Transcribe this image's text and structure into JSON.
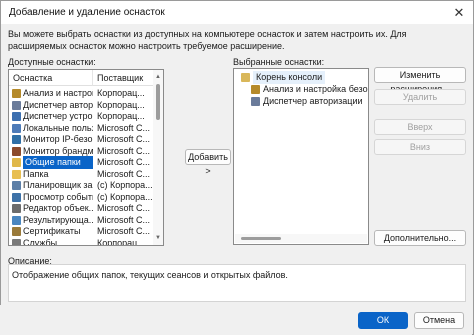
{
  "window": {
    "title": "Добавление и удаление оснасток",
    "close_glyph": "✕"
  },
  "intro": {
    "line1": "Вы можете выбрать оснастки из доступных на компьютере оснасток и затем настроить их. Для",
    "line2": "расширяемых оснасток можно настроить требуемое расширение."
  },
  "available": {
    "label": "Доступные оснастки:",
    "columns": [
      "Оснастка",
      "Поставщик"
    ],
    "items": [
      {
        "name": "Анализ и настройка...",
        "vendor": "Корпорац...",
        "icon": "security-analysis-icon",
        "color": "#b58a2a"
      },
      {
        "name": "Диспетчер автор...",
        "vendor": "Корпорац...",
        "icon": "authorization-manager-icon",
        "color": "#6a7b9a"
      },
      {
        "name": "Диспетчер устро...",
        "vendor": "Корпорац...",
        "icon": "device-manager-icon",
        "color": "#3c6fb0"
      },
      {
        "name": "Локальные польз...",
        "vendor": "Microsoft C...",
        "icon": "local-users-icon",
        "color": "#4d7bb8"
      },
      {
        "name": "Монитор IP-безо...",
        "vendor": "Microsoft C...",
        "icon": "ip-security-monitor-icon",
        "color": "#2f6fa6"
      },
      {
        "name": "Монитор брандм...",
        "vendor": "Microsoft C...",
        "icon": "firewall-monitor-icon",
        "color": "#8b4a2b"
      },
      {
        "name": "Общие папки",
        "vendor": "Microsoft C...",
        "icon": "shared-folders-icon",
        "color": "#e0b84a",
        "selected": true
      },
      {
        "name": "Папка",
        "vendor": "Microsoft C...",
        "icon": "folder-icon",
        "color": "#e8bf52"
      },
      {
        "name": "Планировщик за...",
        "vendor": "(с) Корпора...",
        "icon": "task-scheduler-icon",
        "color": "#5c7fa8"
      },
      {
        "name": "Просмотр событий",
        "vendor": "(с) Корпора...",
        "icon": "event-viewer-icon",
        "color": "#3e72a8"
      },
      {
        "name": "Редактор объек...",
        "vendor": "Microsoft C...",
        "icon": "object-editor-icon",
        "color": "#6c6c6c"
      },
      {
        "name": "Результирующа...",
        "vendor": "Microsoft C...",
        "icon": "rsop-icon",
        "color": "#4a86c0"
      },
      {
        "name": "Сертификаты",
        "vendor": "Microsoft C...",
        "icon": "certificates-icon",
        "color": "#9a7a3a"
      },
      {
        "name": "Службы",
        "vendor": "Корпорац...",
        "icon": "services-icon",
        "color": "#7a7a7a"
      }
    ]
  },
  "add_button": "Добавить >",
  "selected": {
    "label": "Выбранные оснастки:",
    "root": "Корень консоли",
    "children": [
      {
        "name": "Анализ и настройка безопасн",
        "icon": "security-analysis-icon",
        "color": "#b58a2a"
      },
      {
        "name": "Диспетчер авторизации",
        "icon": "authorization-manager-icon",
        "color": "#6a7b9a"
      }
    ]
  },
  "right_buttons": {
    "edit_extensions": "Изменить расширения...",
    "remove": "Удалить",
    "up": "Вверх",
    "down": "Вниз",
    "advanced": "Дополнительно..."
  },
  "description": {
    "label": "Описание:",
    "text": "Отображение общих папок, текущих сеансов и открытых файлов."
  },
  "footer": {
    "ok": "ОК",
    "cancel": "Отмена"
  }
}
